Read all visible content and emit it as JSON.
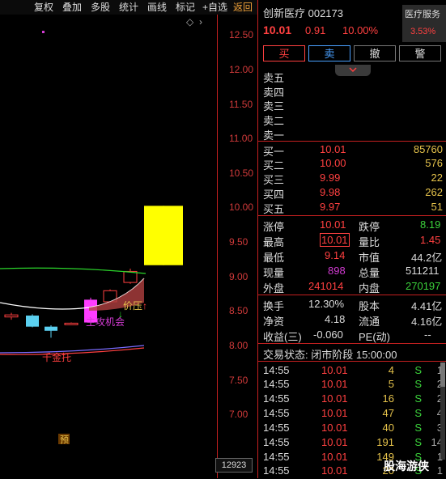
{
  "toolbar": {
    "items": [
      {
        "label": "复权"
      },
      {
        "label": "叠加"
      },
      {
        "label": "多股"
      },
      {
        "label": "统计"
      },
      {
        "label": "画线"
      },
      {
        "label": "标记"
      },
      {
        "label": "+自选"
      },
      {
        "label": "返回"
      }
    ]
  },
  "chart": {
    "price_axis": [
      "12.50",
      "12.00",
      "11.50",
      "11.00",
      "10.50",
      "10.00",
      "9.50",
      "9.00",
      "8.50",
      "8.00",
      "7.50",
      "7.00"
    ],
    "annotations": {
      "squeeze": "价压",
      "attack": "主攻机会",
      "support": "千金托",
      "preview": "预"
    },
    "volume_box": "12923"
  },
  "chart_data": {
    "type": "candlestick",
    "ylim": [
      6.5,
      12.8
    ],
    "candles": [
      {
        "o": 8.4,
        "h": 8.46,
        "l": 8.36,
        "c": 8.43
      },
      {
        "o": 8.42,
        "h": 8.44,
        "l": 8.25,
        "c": 8.26
      },
      {
        "o": 8.26,
        "h": 8.28,
        "l": 8.1,
        "c": 8.2
      },
      {
        "o": 8.3,
        "h": 8.32,
        "l": 8.29,
        "c": 8.31
      },
      {
        "o": 8.32,
        "h": 8.68,
        "l": 8.3,
        "c": 8.65
      },
      {
        "o": 8.62,
        "h": 8.8,
        "l": 8.6,
        "c": 8.78
      },
      {
        "o": 8.9,
        "h": 9.1,
        "l": 8.88,
        "c": 9.06
      },
      {
        "o": 9.15,
        "h": 10.01,
        "l": 9.15,
        "c": 10.01
      }
    ],
    "ma_long_color": "#2bd62b",
    "ma_mid_color": "#ffffff",
    "ma_short_color": "#7a6cff"
  },
  "stock": {
    "name": "创新医疗 002173",
    "price": "10.01",
    "change": "0.91",
    "change_pct": "10.00%",
    "sector_name": "医疗服务",
    "sector_pct": "3.53%"
  },
  "actions": {
    "buy": "买",
    "sell": "卖",
    "cancel": "撤",
    "alert": "警"
  },
  "sell_levels": [
    {
      "label": "卖五"
    },
    {
      "label": "卖四"
    },
    {
      "label": "卖三"
    },
    {
      "label": "卖二"
    },
    {
      "label": "卖一"
    }
  ],
  "buy_levels": [
    {
      "label": "买一",
      "price": "10.01",
      "vol": "85760"
    },
    {
      "label": "买二",
      "price": "10.00",
      "vol": "576"
    },
    {
      "label": "买三",
      "price": "9.99",
      "vol": "22"
    },
    {
      "label": "买四",
      "price": "9.98",
      "vol": "262"
    },
    {
      "label": "买五",
      "price": "9.97",
      "vol": "51"
    }
  ],
  "stats": {
    "limit_up_label": "涨停",
    "limit_up": "10.01",
    "limit_down_label": "跌停",
    "limit_down": "8.19",
    "high_label": "最高",
    "high": "10.01",
    "vol_ratio_label": "量比",
    "vol_ratio": "1.45",
    "low_label": "最低",
    "low": "9.14",
    "mkt_cap_label": "市值",
    "mkt_cap": "44.2亿",
    "last_vol_label": "现量",
    "last_vol": "898",
    "total_vol_label": "总量",
    "total_vol": "511211",
    "outer_label": "外盘",
    "outer": "241014",
    "inner_label": "内盘",
    "inner": "270197",
    "turnover_label": "换手",
    "turnover": "12.30%",
    "shares_label": "股本",
    "shares": "4.41亿",
    "nav_label": "净资",
    "nav": "4.18",
    "float_label": "流通",
    "float": "4.16亿",
    "eps_label": "收益(三)",
    "eps": "-0.060",
    "pe_label": "PE(动)",
    "pe": "--"
  },
  "status": "交易状态: 闭市阶段 15:00:00",
  "ticks": [
    {
      "time": "14:55",
      "price": "10.01",
      "vol": "4",
      "dir": "S",
      "cnt": "1"
    },
    {
      "time": "14:55",
      "price": "10.01",
      "vol": "5",
      "dir": "S",
      "cnt": "2"
    },
    {
      "time": "14:55",
      "price": "10.01",
      "vol": "16",
      "dir": "S",
      "cnt": "2"
    },
    {
      "time": "14:55",
      "price": "10.01",
      "vol": "47",
      "dir": "S",
      "cnt": "4"
    },
    {
      "time": "14:55",
      "price": "10.01",
      "vol": "40",
      "dir": "S",
      "cnt": "3"
    },
    {
      "time": "14:55",
      "price": "10.01",
      "vol": "191",
      "dir": "S",
      "cnt": "14"
    },
    {
      "time": "14:55",
      "price": "10.01",
      "vol": "149",
      "dir": "S",
      "cnt": "1"
    },
    {
      "time": "14:55",
      "price": "10.01",
      "vol": "20",
      "dir": "S",
      "cnt": "1"
    }
  ],
  "watermark": "股海游侠"
}
